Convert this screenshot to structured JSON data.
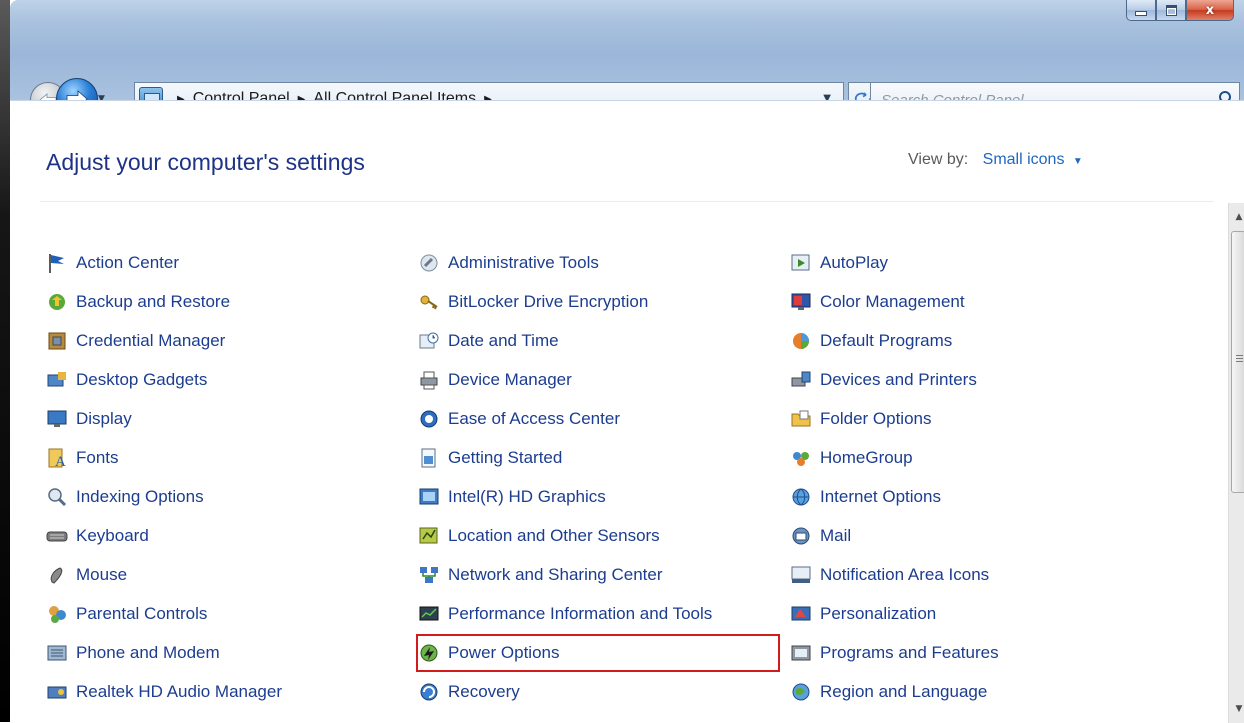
{
  "window": {
    "controls": {
      "minimize": "minimize",
      "maximize": "maximize",
      "close": "x"
    }
  },
  "address": {
    "crumbs": [
      "Control Panel",
      "All Control Panel Items"
    ]
  },
  "search": {
    "placeholder": "Search Control Panel"
  },
  "header": {
    "title": "Adjust your computer's settings",
    "view_by_label": "View by:",
    "view_by_value": "Small icons"
  },
  "items": {
    "col1": [
      {
        "label": "Action Center",
        "icon": "flag-icon"
      },
      {
        "label": "Backup and Restore",
        "icon": "backup-icon"
      },
      {
        "label": "Credential Manager",
        "icon": "vault-icon"
      },
      {
        "label": "Desktop Gadgets",
        "icon": "gadgets-icon"
      },
      {
        "label": "Display",
        "icon": "monitor-icon"
      },
      {
        "label": "Fonts",
        "icon": "fonts-icon"
      },
      {
        "label": "Indexing Options",
        "icon": "magnifier-icon"
      },
      {
        "label": "Keyboard",
        "icon": "keyboard-icon"
      },
      {
        "label": "Mouse",
        "icon": "mouse-icon"
      },
      {
        "label": "Parental Controls",
        "icon": "parental-icon"
      },
      {
        "label": "Phone and Modem",
        "icon": "phone-icon"
      },
      {
        "label": "Realtek HD Audio Manager",
        "icon": "audio-icon"
      }
    ],
    "col2": [
      {
        "label": "Administrative Tools",
        "icon": "tools-icon"
      },
      {
        "label": "BitLocker Drive Encryption",
        "icon": "key-icon"
      },
      {
        "label": "Date and Time",
        "icon": "clock-icon"
      },
      {
        "label": "Device Manager",
        "icon": "printer-icon"
      },
      {
        "label": "Ease of Access Center",
        "icon": "access-icon"
      },
      {
        "label": "Getting Started",
        "icon": "document-icon"
      },
      {
        "label": "Intel(R) HD Graphics",
        "icon": "intel-icon"
      },
      {
        "label": "Location and Other Sensors",
        "icon": "sensor-icon"
      },
      {
        "label": "Network and Sharing Center",
        "icon": "network-icon"
      },
      {
        "label": "Performance Information and Tools",
        "icon": "performance-icon"
      },
      {
        "label": "Power Options",
        "icon": "battery-icon"
      },
      {
        "label": "Recovery",
        "icon": "recovery-icon"
      }
    ],
    "col3": [
      {
        "label": "AutoPlay",
        "icon": "autoplay-icon"
      },
      {
        "label": "Color Management",
        "icon": "color-monitor-icon"
      },
      {
        "label": "Default Programs",
        "icon": "default-programs-icon"
      },
      {
        "label": "Devices and Printers",
        "icon": "devices-icon"
      },
      {
        "label": "Folder Options",
        "icon": "folder-icon"
      },
      {
        "label": "HomeGroup",
        "icon": "homegroup-icon"
      },
      {
        "label": "Internet Options",
        "icon": "globe-icon"
      },
      {
        "label": "Mail",
        "icon": "mail-icon"
      },
      {
        "label": "Notification Area Icons",
        "icon": "notification-icon"
      },
      {
        "label": "Personalization",
        "icon": "personalization-icon"
      },
      {
        "label": "Programs and Features",
        "icon": "programs-icon"
      },
      {
        "label": "Region and Language",
        "icon": "region-icon"
      }
    ]
  },
  "highlighted_item": "Power Options",
  "colors": {
    "link": "#1c3d8f",
    "title": "#1e3287",
    "highlight": "#d21b1b"
  }
}
